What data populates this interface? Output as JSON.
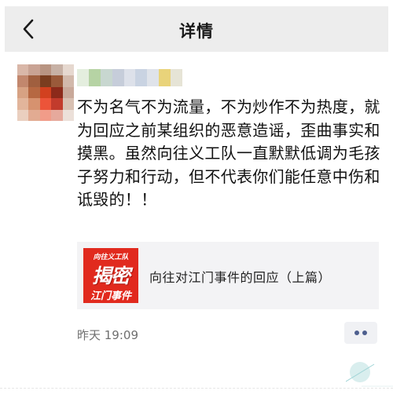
{
  "header": {
    "title": "详情",
    "back_icon": "chevron-left-icon"
  },
  "post": {
    "text": "不为名气不为流量，不为炒作不为热度，就为回应之前某组织的恶意造谣，歪曲事实和摸黑。虽然向往义工队一直默默低调为毛孩子努力和行动，但不代表你们能任意中伤和诋毁的！！",
    "timestamp": "昨天 19:09"
  },
  "link_card": {
    "thumbnail_text": [
      "向往义工队",
      "揭密",
      "江门事件"
    ],
    "title": "向往对江门事件的回应（上篇）"
  },
  "actions": {
    "more_icon": "more-dots-icon"
  },
  "colors": {
    "header_bg": "#ededed",
    "card_bg": "#f3f3f5",
    "thumb_red": "#e12a1e",
    "dots": "#4d5f8e",
    "meta_gray": "#6f6f6f"
  }
}
